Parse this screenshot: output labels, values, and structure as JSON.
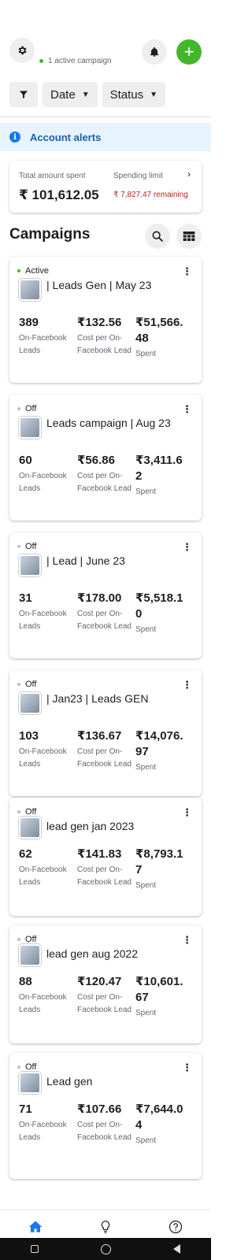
{
  "header": {
    "active_campaigns": "1 active campaign"
  },
  "filters": {
    "date_label": "Date",
    "status_label": "Status"
  },
  "alerts": {
    "label": "Account alerts"
  },
  "spend": {
    "total_label": "Total amount spent",
    "total_value": "₹ 101,612.05",
    "limit_label": "Spending limit",
    "limit_remaining": "₹ 7,827.47 remaining"
  },
  "campaigns_title": "Campaigns",
  "metric_labels": {
    "leads": "On-Facebook Leads",
    "cost": "Cost per On-Facebook Lead",
    "spent": "Spent"
  },
  "campaigns": [
    {
      "status": "Active",
      "name": "| Leads Gen | May 23",
      "leads": "389",
      "cost": "₹132.56",
      "spent": "₹51,566.48"
    },
    {
      "status": "Off",
      "name": "Leads campaign | Aug 23",
      "leads": "60",
      "cost": "₹56.86",
      "spent": "₹3,411.62"
    },
    {
      "status": "Off",
      "name": "| Lead | June 23",
      "leads": "31",
      "cost": "₹178.00",
      "spent": "₹5,518.10"
    },
    {
      "status": "Off",
      "name": "| Jan23 | Leads GEN",
      "leads": "103",
      "cost": "₹136.67",
      "spent": "₹14,076.97"
    },
    {
      "status": "Off",
      "name": "lead gen jan 2023",
      "leads": "62",
      "cost": "₹141.83",
      "spent": "₹8,793.17"
    },
    {
      "status": "Off",
      "name": "lead gen aug 2022",
      "leads": "88",
      "cost": "₹120.47",
      "spent": "₹10,601.67"
    },
    {
      "status": "Off",
      "name": "Lead gen",
      "leads": "71",
      "cost": "₹107.66",
      "spent": "₹7,644.04"
    }
  ],
  "icons": {
    "settings": "gear-icon",
    "notifications": "bell-icon",
    "add": "plus-icon",
    "filter": "funnel-icon",
    "search": "search-icon",
    "table": "table-icon",
    "home": "home-icon",
    "ideas": "lightbulb-icon",
    "help": "question-icon"
  },
  "colors": {
    "accent": "#1877f2",
    "add_button": "#42b72a",
    "alert_bg": "#e7f3ff",
    "remaining_text": "#b3261e"
  }
}
